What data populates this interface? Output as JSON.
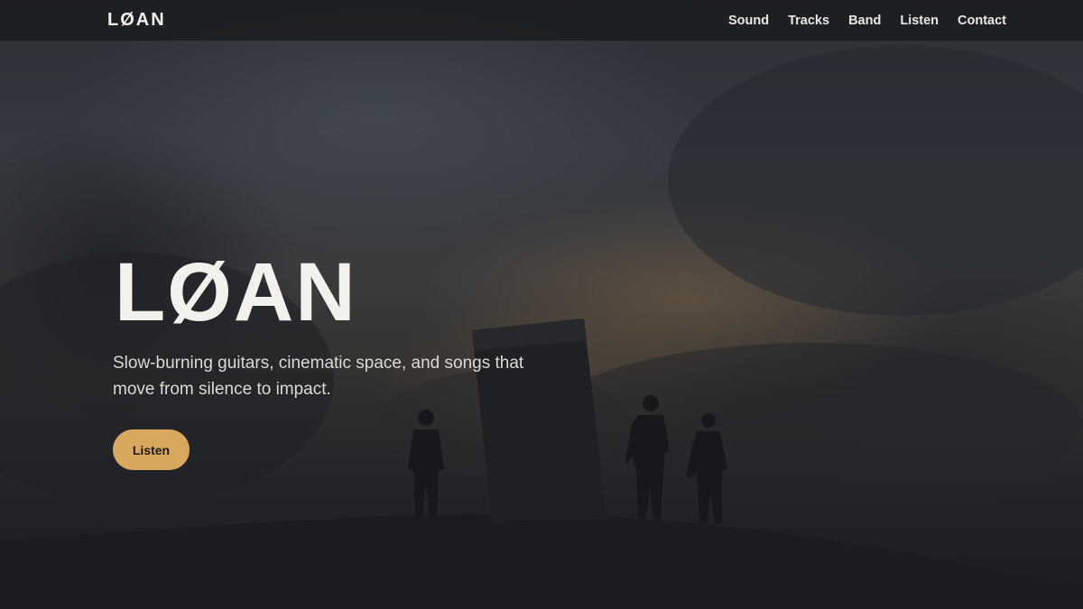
{
  "nav": {
    "brand": "LØAN",
    "links": [
      "Sound",
      "Tracks",
      "Band",
      "Listen",
      "Contact"
    ]
  },
  "hero": {
    "title": "LØAN",
    "tagline": "Slow-burning guitars, cinematic space, and songs that move from silence to impact.",
    "cta_label": "Listen"
  },
  "colors": {
    "accent": "#d9a85f",
    "nav_bg": "#1c1e21",
    "text_light": "#f3f1ec"
  }
}
